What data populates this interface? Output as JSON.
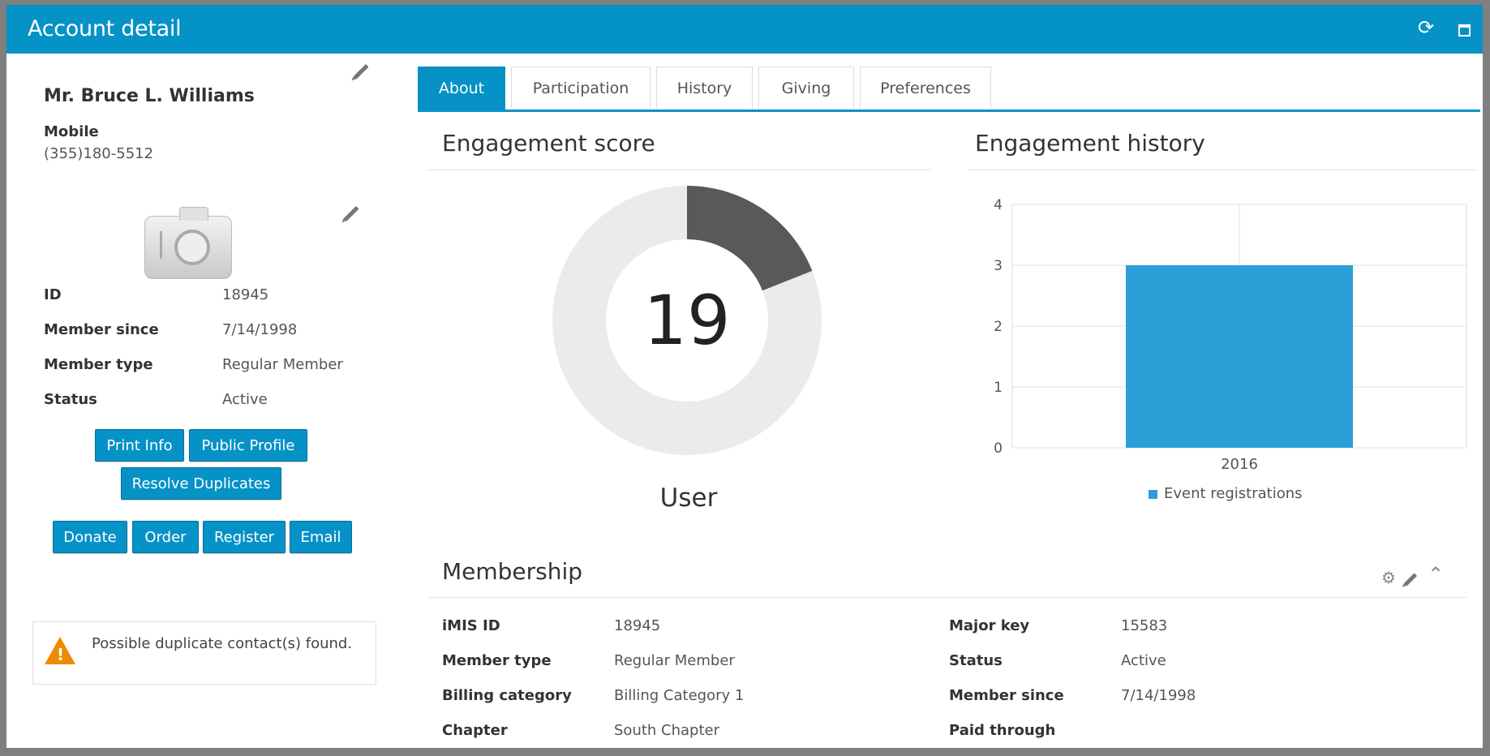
{
  "window": {
    "title": "Account detail"
  },
  "profile": {
    "name": "Mr. Bruce L. Williams",
    "mobile_label": "Mobile",
    "mobile_value": "(355)180-5512",
    "fields": [
      {
        "label": "ID",
        "value": "18945"
      },
      {
        "label": "Member since",
        "value": "7/14/1998"
      },
      {
        "label": "Member type",
        "value": "Regular Member"
      },
      {
        "label": "Status",
        "value": "Active"
      }
    ],
    "buttons": {
      "print_info": "Print Info",
      "public_profile": "Public Profile",
      "resolve_duplicates": "Resolve Duplicates",
      "donate": "Donate",
      "order": "Order",
      "register": "Register",
      "email": "Email"
    },
    "warning": "Possible duplicate contact(s) found."
  },
  "tabs": [
    {
      "label": "About"
    },
    {
      "label": "Participation"
    },
    {
      "label": "History"
    },
    {
      "label": "Giving"
    },
    {
      "label": "Preferences"
    }
  ],
  "engagement_score": {
    "title": "Engagement score",
    "score": "19",
    "label": "User",
    "fraction": 0.19
  },
  "engagement_history": {
    "title": "Engagement history"
  },
  "chart_data": {
    "type": "bar",
    "categories": [
      "2016"
    ],
    "series": [
      {
        "name": "Event registrations",
        "values": [
          3
        ]
      }
    ],
    "ylim": [
      0,
      4
    ],
    "yticks": [
      "0",
      "1",
      "2",
      "3",
      "4"
    ],
    "legend": "bottom",
    "grid": true,
    "colors": [
      "#2a9fd8"
    ]
  },
  "membership": {
    "title": "Membership",
    "left": [
      {
        "label": "iMIS ID",
        "value": "18945"
      },
      {
        "label": "Member type",
        "value": "Regular Member"
      },
      {
        "label": "Billing category",
        "value": "Billing Category 1"
      },
      {
        "label": "Chapter",
        "value": "South Chapter"
      }
    ],
    "right": [
      {
        "label": "Major key",
        "value": "15583"
      },
      {
        "label": "Status",
        "value": "Active"
      },
      {
        "label": "Member since",
        "value": "7/14/1998"
      },
      {
        "label": "Paid through",
        "value": ""
      }
    ]
  },
  "colors": {
    "accent": "#0592c6",
    "warning": "#f08a00",
    "donut_filled": "#58595b",
    "donut_empty": "#ebebeb"
  }
}
